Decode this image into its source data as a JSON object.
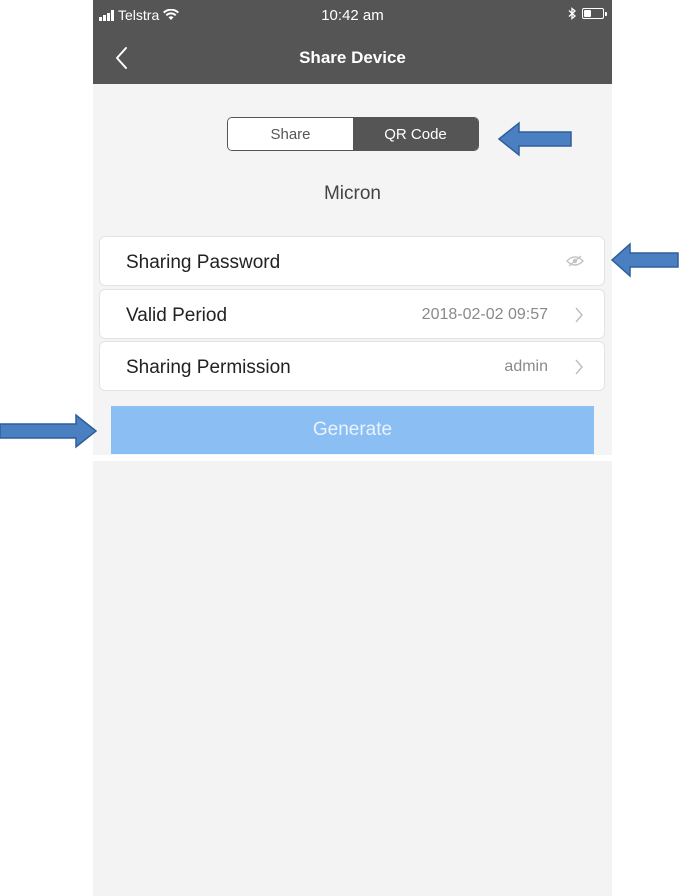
{
  "status_bar": {
    "carrier": "Telstra",
    "time": "10:42 am",
    "battery_level": 0.4
  },
  "nav": {
    "title": "Share Device",
    "back_icon": "chevron-left-icon"
  },
  "segmented": {
    "tabs": [
      {
        "label": "Share",
        "active": false
      },
      {
        "label": "QR Code",
        "active": true
      }
    ]
  },
  "device_name": "Micron",
  "fields": {
    "password": {
      "label": "Sharing Password",
      "icon": "eye-icon"
    },
    "valid_period": {
      "label": "Valid Period",
      "value": "2018-02-02 09:57"
    },
    "permission": {
      "label": "Sharing Permission",
      "value": "admin"
    }
  },
  "generate": {
    "label": "Generate"
  },
  "colors": {
    "header": "#555555",
    "button": "#8bbef2",
    "annotation_arrow": "#4a7fc1"
  }
}
